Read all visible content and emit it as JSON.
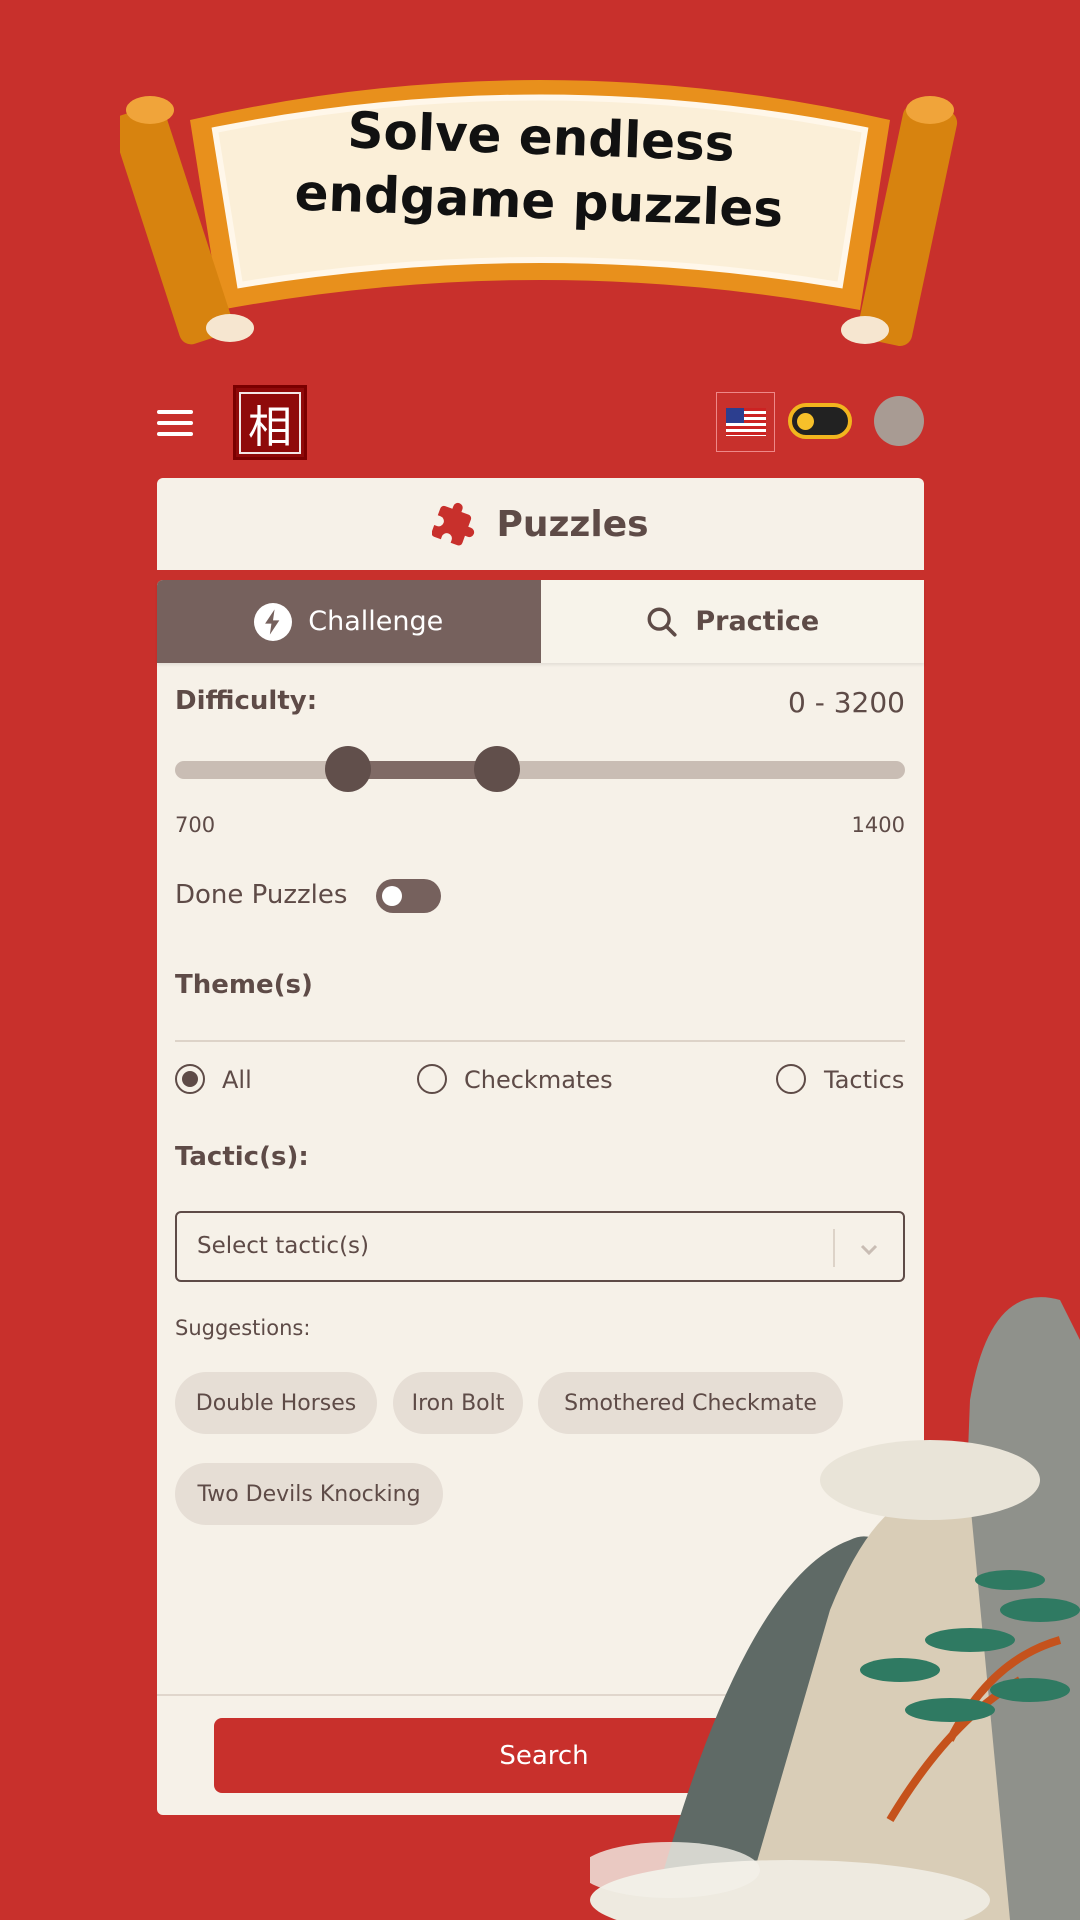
{
  "banner": {
    "line1": "Solve endless",
    "line2": "endgame puzzles"
  },
  "header": {
    "logo_char": "相",
    "menu_icon": "hamburger-icon",
    "language": "en-US",
    "theme_toggle": "light",
    "colors": {
      "background": "#c8302c",
      "accent": "#f2b51e"
    }
  },
  "page_title": "Puzzles",
  "tabs": [
    {
      "label": "Challenge",
      "icon": "lightning-icon",
      "active": true
    },
    {
      "label": "Practice",
      "icon": "search-icon",
      "active": false
    }
  ],
  "difficulty": {
    "label": "Difficulty:",
    "range_text": "0 - 3200",
    "min": 0,
    "max": 3200,
    "low": 700,
    "high": 1400,
    "low_label": "700",
    "high_label": "1400"
  },
  "done_puzzles": {
    "label": "Done Puzzles",
    "on": false
  },
  "themes": {
    "label": "Theme(s)",
    "options": [
      {
        "label": "All",
        "selected": true
      },
      {
        "label": "Checkmates",
        "selected": false
      },
      {
        "label": "Tactics",
        "selected": false
      }
    ]
  },
  "tactics": {
    "label": "Tactic(s):",
    "placeholder": "Select tactic(s)"
  },
  "suggestions": {
    "label": "Suggestions:",
    "chips": [
      "Double Horses",
      "Iron Bolt",
      "Smothered Checkmate",
      "Two Devils Knocking"
    ]
  },
  "search_button": "Search"
}
